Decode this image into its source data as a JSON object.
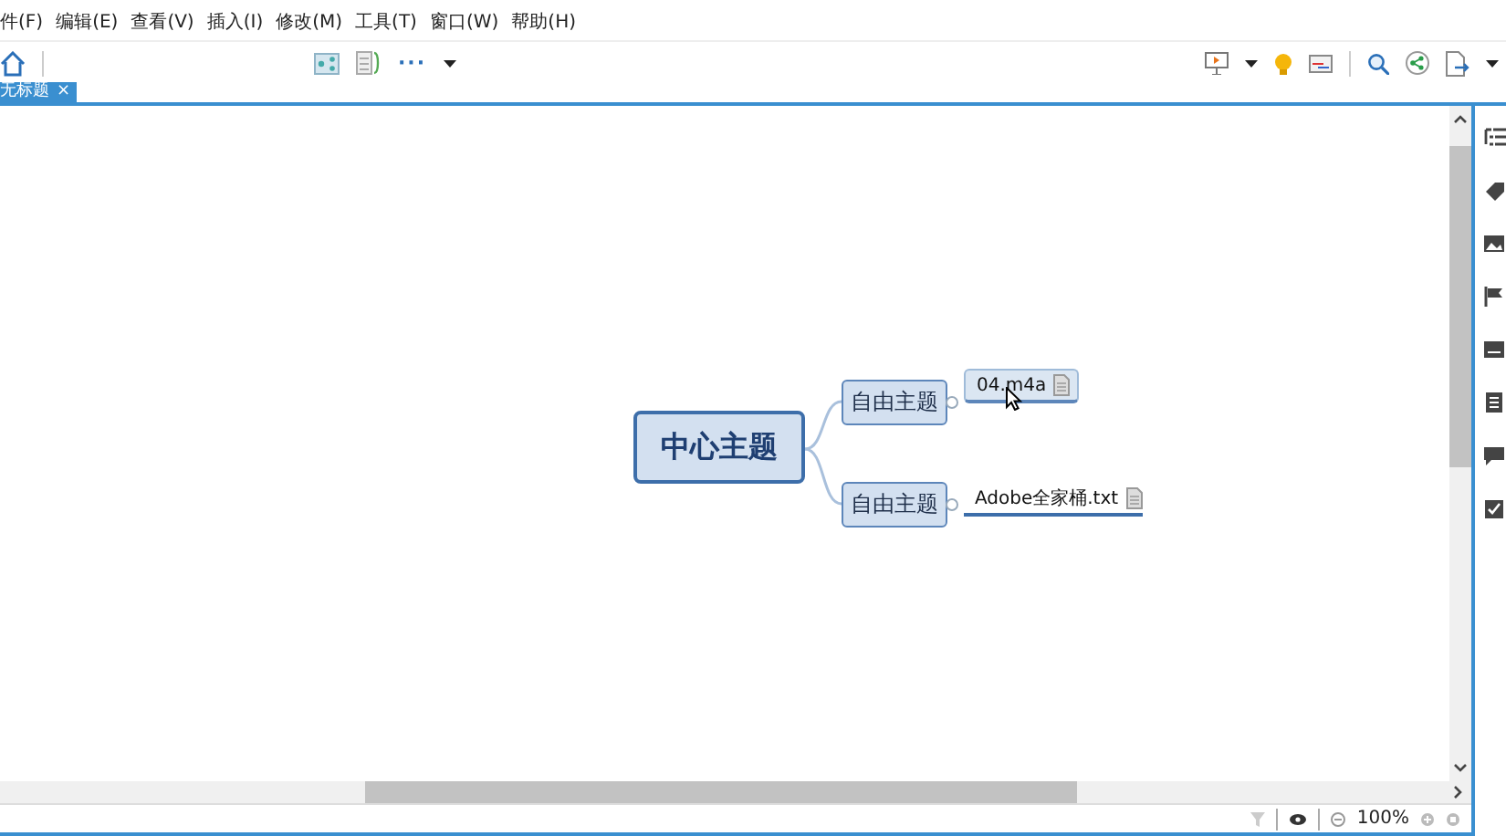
{
  "menu_bar": [
    "件(F)",
    "编辑(E)",
    "查看(V)",
    "插入(I)",
    "修改(M)",
    "工具(T)",
    "窗口(W)",
    "帮助(H)"
  ],
  "toolbar": {
    "more": "···"
  },
  "tabs": [
    {
      "label": "无标题",
      "selected": true,
      "close": "×"
    }
  ],
  "mind_map": {
    "central": "中心主题",
    "branches": [
      {
        "label": "自由主题",
        "attachment": {
          "label": "04.m4a",
          "selected": true
        }
      },
      {
        "label": "自由主题",
        "attachment": {
          "label": "Adobe全家桶.txt",
          "selected": false
        }
      }
    ]
  },
  "status_bar": {
    "zoom": "100%"
  }
}
